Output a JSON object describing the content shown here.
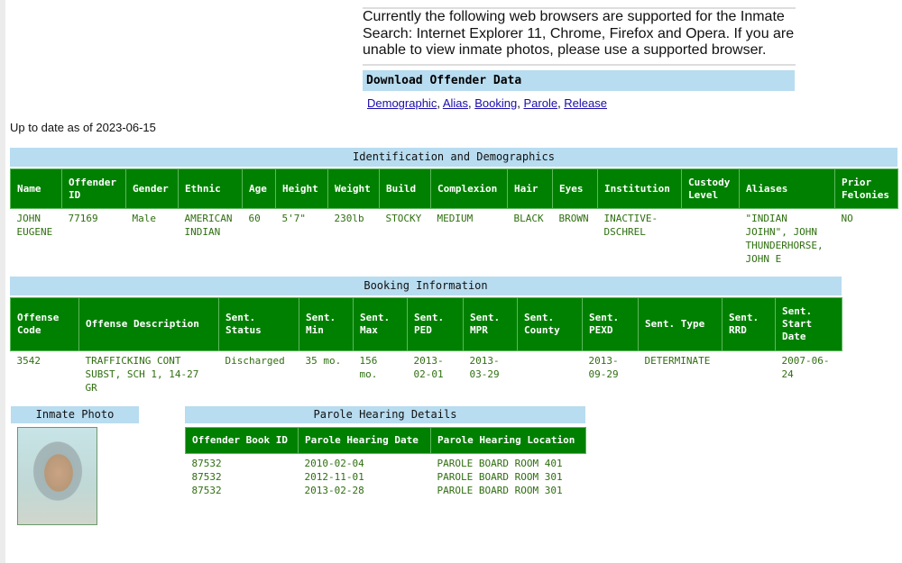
{
  "notice": "Currently the following web browsers are supported for the Inmate Search: Internet Explorer 11, Chrome, Firefox and Opera. If you are unable to view inmate photos, please use a supported browser.",
  "download": {
    "title": "Download Offender Data",
    "links": [
      "Demographic",
      "Alias",
      "Booking",
      "Parole",
      "Release"
    ]
  },
  "up_to_date": "Up to date as of 2023-06-15",
  "identification": {
    "title": "Identification and Demographics",
    "headers": [
      "Name",
      "Offender ID",
      "Gender",
      "Ethnic",
      "Age",
      "Height",
      "Weight",
      "Build",
      "Complexion",
      "Hair",
      "Eyes",
      "Institution",
      "Custody Level",
      "Aliases",
      "Prior Felonies"
    ],
    "row": [
      "JOHN EUGENE",
      "77169",
      "Male",
      "AMERICAN INDIAN",
      "60",
      "5'7\"",
      "230lb",
      "STOCKY",
      "MEDIUM",
      "BLACK",
      "BROWN",
      "INACTIVE-DSCHREL",
      "",
      "\"INDIAN JOIHN\", JOHN THUNDERHORSE, JOHN E",
      "NO"
    ]
  },
  "booking": {
    "title": "Booking Information",
    "headers": [
      "Offense Code",
      "Offense Description",
      "Sent. Status",
      "Sent. Min",
      "Sent. Max",
      "Sent. PED",
      "Sent. MPR",
      "Sent. County",
      "Sent. PEXD",
      "Sent. Type",
      "Sent. RRD",
      "Sent. Start Date"
    ],
    "row": [
      "3542",
      "TRAFFICKING CONT SUBST, SCH 1, 14-27 GR",
      "Discharged",
      "35 mo.",
      "156 mo.",
      "2013-02-01",
      "2013-03-29",
      "",
      "2013-09-29",
      "DETERMINATE",
      "",
      "2007-06-24"
    ]
  },
  "photo": {
    "title": "Inmate Photo"
  },
  "parole": {
    "title": "Parole Hearing Details",
    "headers": [
      "Offender Book ID",
      "Parole Hearing Date",
      "Parole Hearing Location"
    ],
    "rows": [
      [
        "87532",
        "2010-02-04",
        "PAROLE BOARD ROOM 401"
      ],
      [
        "87532",
        "2012-11-01",
        "PAROLE BOARD ROOM 301"
      ],
      [
        "87532",
        "2013-02-28",
        "PAROLE BOARD ROOM 301"
      ]
    ]
  }
}
